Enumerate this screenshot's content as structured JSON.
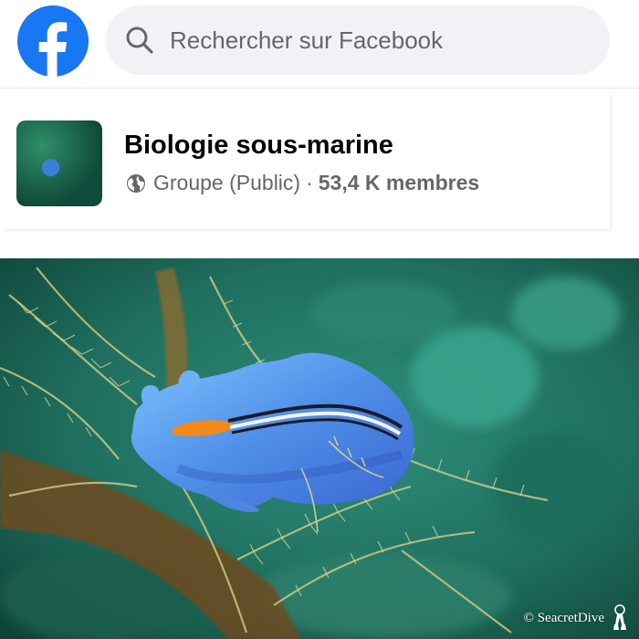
{
  "header": {
    "logo_name": "facebook-logo",
    "search": {
      "placeholder": "Rechercher sur Facebook",
      "icon": "search-icon"
    },
    "brand_color": "#1877f2"
  },
  "group": {
    "name": "Biologie sous-marine",
    "privacy_icon": "globe-icon",
    "privacy": "Groupe (Public)",
    "separator": "·",
    "members": "53,4 K membres"
  },
  "photo": {
    "subject": "photo",
    "watermark": "© SeacretDive"
  }
}
